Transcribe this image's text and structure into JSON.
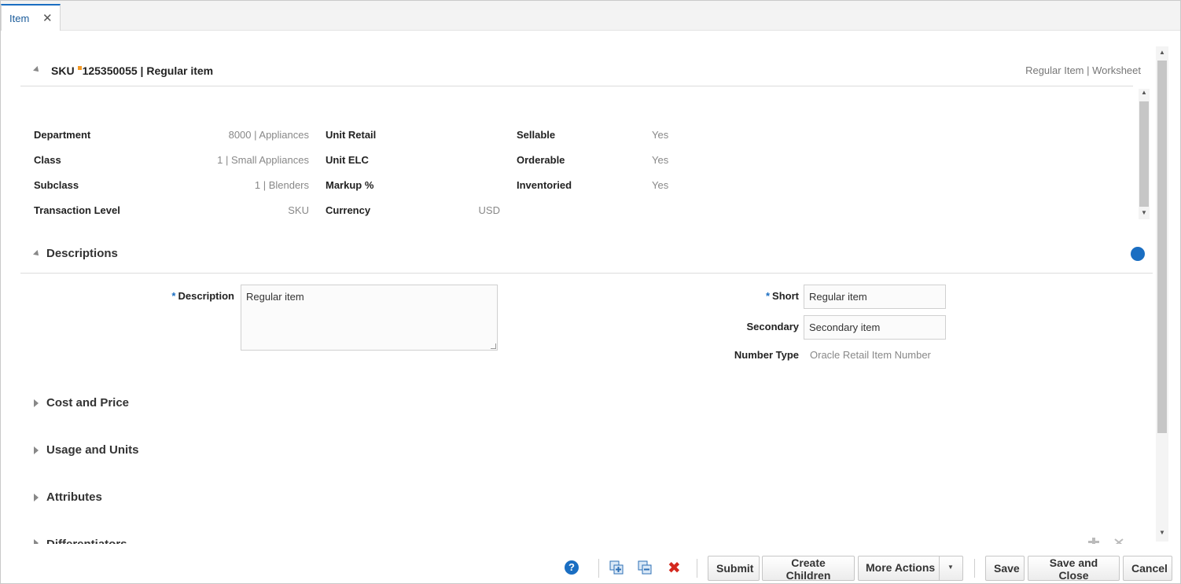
{
  "tab": {
    "label": "Item",
    "close": "✕"
  },
  "header": {
    "sku_label": "SKU",
    "sku_value": "125350055 | Regular item",
    "right_text": "Regular Item  |  Worksheet"
  },
  "summary": {
    "col1": [
      {
        "label": "Department",
        "value": "8000 | Appliances"
      },
      {
        "label": "Class",
        "value": "1 | Small Appliances"
      },
      {
        "label": "Subclass",
        "value": "1 | Blenders"
      },
      {
        "label": "Transaction Level",
        "value": "SKU"
      }
    ],
    "col2": [
      {
        "label": "Unit Retail",
        "value": ""
      },
      {
        "label": "Unit ELC",
        "value": ""
      },
      {
        "label": "Markup %",
        "value": ""
      },
      {
        "label": "Currency",
        "value": "USD"
      }
    ],
    "col3": [
      {
        "label": "Sellable",
        "value": "Yes"
      },
      {
        "label": "Orderable",
        "value": "Yes"
      },
      {
        "label": "Inventoried",
        "value": "Yes"
      }
    ]
  },
  "descriptions": {
    "title": "Descriptions",
    "required_mark": "*",
    "description_label": "Description",
    "description_value": "Regular item",
    "short_label": "Short",
    "short_value": "Regular item",
    "secondary_label": "Secondary",
    "secondary_value": "Secondary item",
    "number_type_label": "Number Type",
    "number_type_value": "Oracle Retail Item Number",
    "globe_glyph": "●"
  },
  "sections": {
    "cost_price": "Cost and Price",
    "usage_units": "Usage and Units",
    "attributes": "Attributes",
    "differentiators": "Differentiators"
  },
  "footer": {
    "help_glyph": "?",
    "delete_glyph": "✖",
    "submit": "Submit",
    "create_children": "Create Children",
    "more_actions": "More Actions",
    "more_caret": "▼",
    "save": "Save",
    "save_close": "Save and Close",
    "cancel": "Cancel"
  },
  "icons": {
    "expanded": "triangle-down-icon",
    "collapsed": "triangle-right-icon",
    "globe": "globe-icon",
    "help": "help-icon",
    "add_row": "add-row-icon",
    "duplicate": "duplicate-icon",
    "delete": "delete-icon"
  },
  "colors": {
    "accent": "#1a6ec2",
    "flag": "#f39a25",
    "delete": "#d4281e"
  }
}
